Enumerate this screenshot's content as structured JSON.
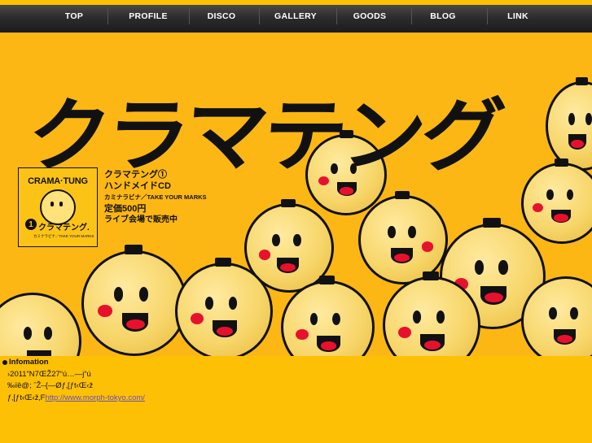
{
  "nav": {
    "items": [
      {
        "label": "TOP"
      },
      {
        "label": "PROFILE"
      },
      {
        "label": "DISCO"
      },
      {
        "label": "GALLERY"
      },
      {
        "label": "GOODS"
      },
      {
        "label": "BLOG"
      },
      {
        "label": "LINK"
      }
    ]
  },
  "hero": {
    "logo_text": "クラマテング",
    "jacket": {
      "title": "CRAMA·TUNG",
      "number": "1",
      "brand": "クラマテング.",
      "subtitle": "カミナラビナ／TAKE YOUR MARKS"
    },
    "promo": {
      "line1": "クラマテング①",
      "line2": "ハンドメイドCD",
      "line3": "カミナラビナ／TAKE YOUR MARKS",
      "line4": "定価500円",
      "line5": "ライブ会場で販売中"
    }
  },
  "info": {
    "heading": "Infomation",
    "line1": "›2011”N7ŒŽ27“ú…—j“ú",
    "line2": "‰ïê@; ˆŽ–{—Øƒ‚[ƒt‹Œ‹ž",
    "line3_prefix": "ƒ‚[ƒt‹Œ‹ž‚F",
    "line3_link": "http://www.morph-tokyo.com/"
  },
  "colors": {
    "background": "#fec005",
    "nav_bar": "#2c2c2c",
    "accent_red": "#e8112d",
    "link": "#6a4fb8"
  }
}
